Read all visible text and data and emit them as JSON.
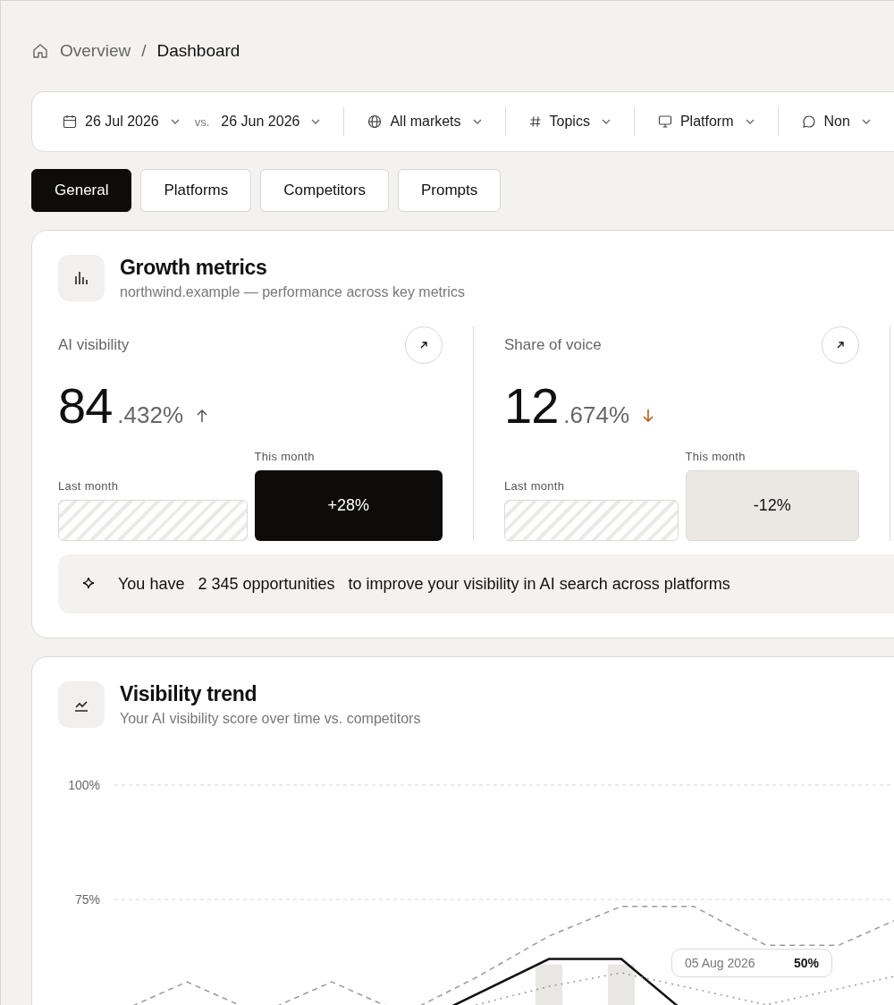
{
  "breadcrumb": {
    "items": [
      {
        "label": "Overview",
        "selected": false
      },
      {
        "label": "Dashboard",
        "selected": true
      }
    ],
    "separator": "/"
  },
  "filters": {
    "date": "26 Jul 2026",
    "vs_label": "vs.",
    "compare_date": "26 Jun 2026",
    "items": [
      {
        "kind": "globe",
        "label": "All markets"
      },
      {
        "kind": "hash",
        "label": "Topics"
      },
      {
        "kind": "monitor",
        "label": "Platform"
      },
      {
        "kind": "chat",
        "label": "Non"
      }
    ]
  },
  "tabs": [
    {
      "label": "General",
      "selected": true
    },
    {
      "label": "Platforms",
      "selected": false
    },
    {
      "label": "Competitors",
      "selected": false
    },
    {
      "label": "Prompts",
      "selected": false
    }
  ],
  "growth_metrics": {
    "title": "Growth metrics",
    "subtitle": "northwind.example — performance across key metrics",
    "metrics": [
      {
        "label": "AI visibility",
        "integer": "84",
        "decimal": ".432%",
        "rising": true,
        "last_month_label": "Last month",
        "this_month_label": "This month",
        "change": "+28%"
      },
      {
        "label": "Share of voice",
        "integer": "12",
        "decimal": ".674%",
        "rising": false,
        "last_month_label": "Last month",
        "this_month_label": "This month",
        "change": "-12%"
      }
    ],
    "opportunity": {
      "lead": "You have",
      "count": "2 345 opportunities",
      "rest": "to improve your visibility in AI search across platforms"
    }
  },
  "visibility_trend": {
    "title": "Visibility trend",
    "subtitle": "Your AI visibility score over time vs. competitors",
    "y_axis_labels": [
      "100%",
      "75%"
    ],
    "tooltip": {
      "date": "05 Aug 2026",
      "value": "50%"
    }
  }
}
